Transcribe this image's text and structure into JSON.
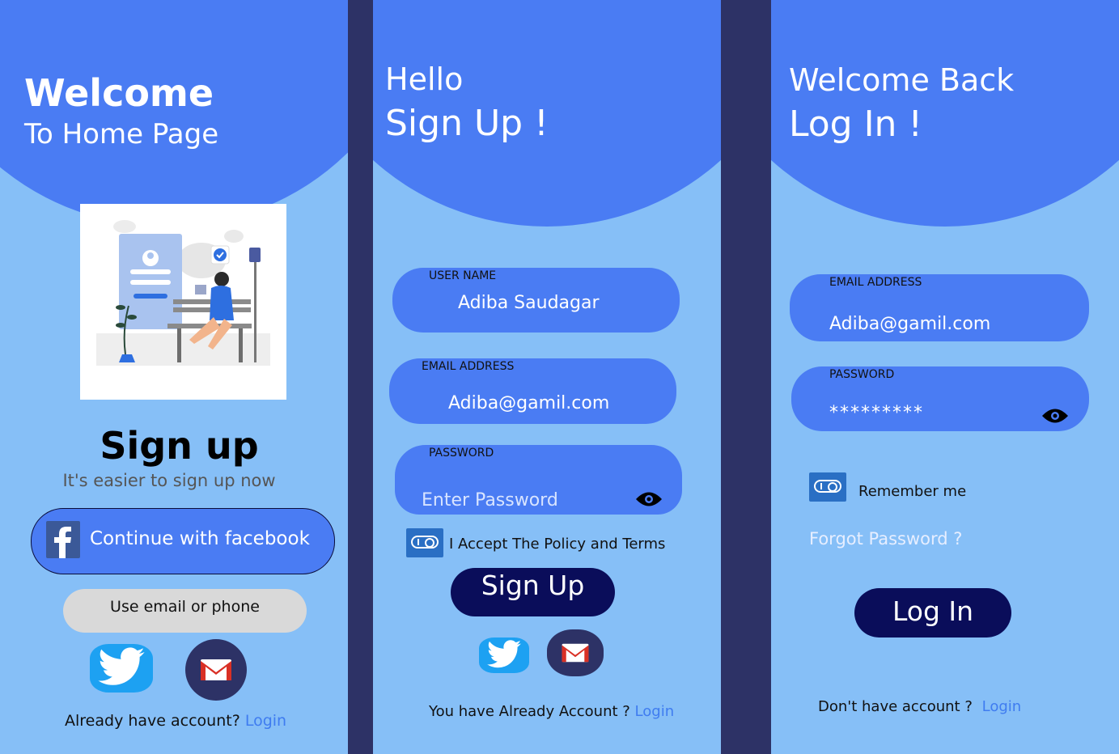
{
  "home": {
    "title": "Welcome",
    "subtitle": "To Home Page",
    "heading": "Sign up",
    "tagline": "It's easier to sign up now",
    "facebook_label": "Continue with facebook",
    "email_phone_label": "Use email or phone",
    "footer_text": "Already have account?",
    "footer_link": "Login"
  },
  "signup": {
    "greeting": "Hello",
    "title": "Sign Up !",
    "username_label": "USER NAME",
    "username_value": "Adiba Saudagar",
    "email_label": "EMAIL ADDRESS",
    "email_value": "Adiba@gamil.com",
    "password_label": "PASSWORD",
    "password_placeholder": "Enter Password",
    "accept_label": "I Accept The Policy and Terms",
    "button_label": "Sign Up",
    "footer_text": "You have Already Account ?",
    "footer_link": "Login"
  },
  "login": {
    "greeting": "Welcome Back",
    "title": "Log In !",
    "email_label": "EMAIL ADDRESS",
    "email_value": "Adiba@gamil.com",
    "password_label": "PASSWORD",
    "password_value": "*********",
    "remember_label": "Remember me",
    "forgot_label": "Forgot Password ?",
    "button_label": "Log In",
    "footer_text": "Don't have account ?",
    "footer_link": "Login"
  },
  "colors": {
    "panel_bg": "#86bff7",
    "accent_blue": "#4a7cf3",
    "dark_navy": "#0a0d5a",
    "divider": "#2d3266",
    "link": "#3f7cf0"
  },
  "icons": [
    "facebook-icon",
    "twitter-icon",
    "gmail-icon",
    "eye-icon",
    "toggle-icon"
  ]
}
